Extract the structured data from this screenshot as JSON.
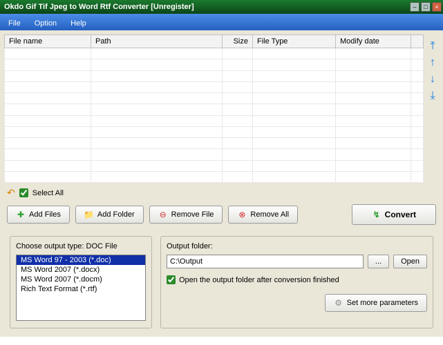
{
  "titlebar": {
    "title": "Okdo Gif Tif Jpeg to Word Rtf Converter [Unregister]"
  },
  "menu": {
    "file": "File",
    "option": "Option",
    "help": "Help"
  },
  "columns": {
    "filename": "File name",
    "path": "Path",
    "size": "Size",
    "filetype": "File Type",
    "modify": "Modify date"
  },
  "selectall": {
    "label": "Select All"
  },
  "buttons": {
    "addfiles": "Add Files",
    "addfolder": "Add Folder",
    "removefile": "Remove File",
    "removeall": "Remove All",
    "convert": "Convert"
  },
  "outtype": {
    "label": "Choose output type:  DOC File",
    "opts": [
      "MS Word 97 - 2003 (*.doc)",
      "MS Word 2007 (*.docx)",
      "MS Word 2007 (*.docm)",
      "Rich Text Format (*.rtf)"
    ]
  },
  "outfolder": {
    "label": "Output folder:",
    "value": "C:\\Output",
    "browse": "...",
    "open": "Open",
    "openafter": "Open the output folder after conversion finished",
    "more": "Set more parameters"
  }
}
